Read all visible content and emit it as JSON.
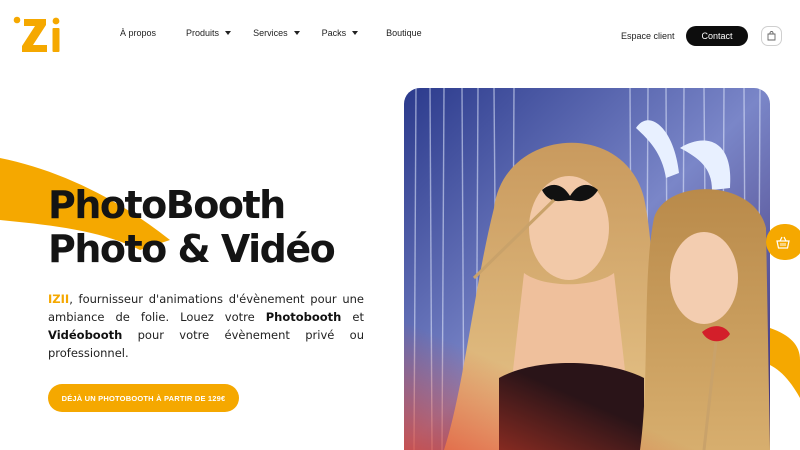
{
  "brand": {
    "logo_text": "Zi",
    "accent_color": "#f5a800",
    "dark_color": "#0d0d0d"
  },
  "nav": {
    "items": [
      {
        "label": "À propos",
        "has_dropdown": false
      },
      {
        "label": "Produits",
        "has_dropdown": true
      },
      {
        "label": "Services",
        "has_dropdown": true
      },
      {
        "label": "Packs",
        "has_dropdown": true
      },
      {
        "label": "Boutique",
        "has_dropdown": false
      }
    ],
    "espace_client": "Espace client",
    "contact": "Contact",
    "cart_icon": "shopping-bag-icon"
  },
  "hero": {
    "title_line1": "PhotoBooth",
    "title_line2": "Photo & Vidéo",
    "desc_brand": "IZII",
    "desc_part1": ", fournisseur d'animations d'évènement pour une ambiance de folie. Louez votre ",
    "desc_bold1": "Photobooth",
    "desc_part2": " et ",
    "desc_bold2": "Vidéobooth",
    "desc_part3": " pour votre évènement privé ou professionnel.",
    "cta": "DÉJÀ UN PHOTOBOOTH À PARTIR DE 129€"
  },
  "floating": {
    "cart_icon": "shopping-basket-icon"
  }
}
